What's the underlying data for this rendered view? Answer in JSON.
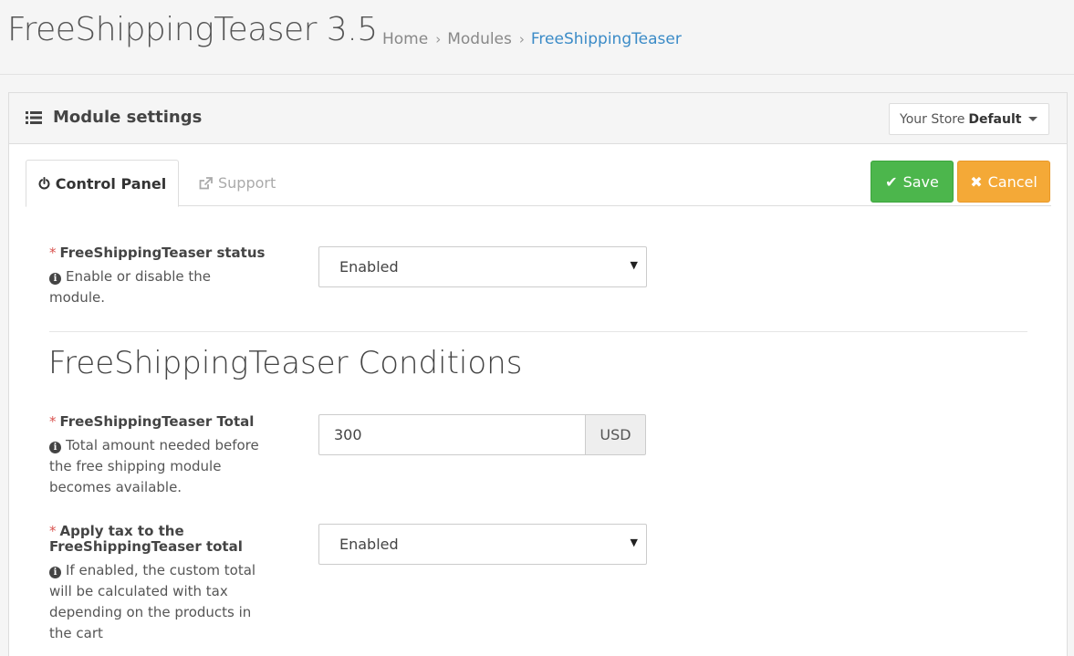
{
  "header": {
    "title": "FreeShippingTeaser 3.5",
    "breadcrumb": [
      {
        "label": "Home"
      },
      {
        "label": "Modules"
      },
      {
        "label": "FreeShippingTeaser"
      }
    ],
    "breadcrumb_separator": "›"
  },
  "panel": {
    "title": "Module settings",
    "title_icon": "list-icon",
    "store_selector": {
      "prefix": "Your Store",
      "value": "Default"
    }
  },
  "tabs": [
    {
      "label": "Control Panel",
      "icon": "power-icon",
      "active": true
    },
    {
      "label": "Support",
      "icon": "external-link-icon",
      "active": false
    }
  ],
  "actions": {
    "save_label": "Save",
    "save_glyph": "✔",
    "cancel_label": "Cancel",
    "cancel_glyph": "✖",
    "save_color": "#4cb64c",
    "cancel_color": "#f4a937"
  },
  "fields": {
    "status": {
      "label": "FreeShippingTeaser status",
      "required_mark": "*",
      "help": "Enable or disable the module.",
      "value": "Enabled"
    },
    "section_title": "FreeShippingTeaser Conditions",
    "total": {
      "label": "FreeShippingTeaser Total",
      "required_mark": "*",
      "help": "Total amount needed before the free shipping module becomes available.",
      "value": "300",
      "addon": "USD"
    },
    "tax": {
      "label": "Apply tax to the FreeShippingTeaser total",
      "required_mark": "*",
      "help": "If enabled, the custom total will be calculated with tax depending on the products in the cart",
      "value": "Enabled"
    }
  },
  "info_glyph": "i",
  "select_arrow": "▼"
}
